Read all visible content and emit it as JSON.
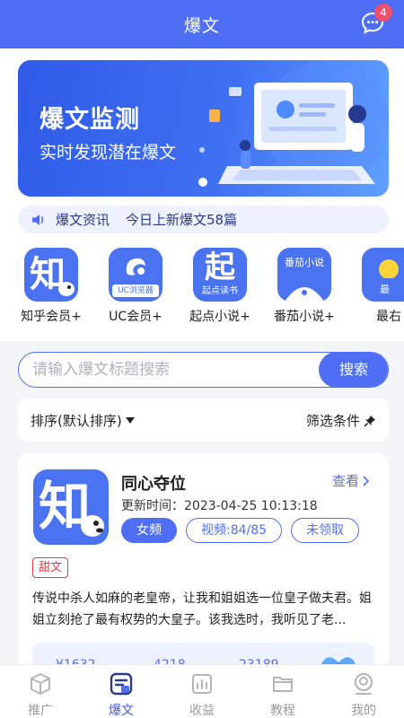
{
  "header": {
    "title": "爆文",
    "message_badge": "4"
  },
  "banner": {
    "title": "爆文监测",
    "subtitle": "实时发现潜在爆文"
  },
  "notice": {
    "label": "爆文资讯",
    "text": "今日上新爆文58篇"
  },
  "apps": [
    {
      "label": "知乎会员+",
      "icon": "zhihu-icon",
      "glyph": "知"
    },
    {
      "label": "UC会员+",
      "icon": "uc-browser-icon",
      "glyph": "UC浏览器"
    },
    {
      "label": "起点小说+",
      "icon": "qidian-icon",
      "glyph": "起",
      "sub": "起点读书"
    },
    {
      "label": "番茄小说+",
      "icon": "fanqie-icon",
      "glyph": "番茄小说"
    },
    {
      "label": "最右",
      "icon": "zuiyou-icon",
      "glyph": "最"
    }
  ],
  "search": {
    "placeholder": "请输入爆文标题搜索",
    "button": "搜索"
  },
  "filters": {
    "sort": "排序(默认排序)",
    "filter": "筛选条件"
  },
  "card": {
    "icon_glyph": "知",
    "title": "同心夺位",
    "view": "查看",
    "update_time": "更新时间：2023-04-25 10:13:18",
    "tags": [
      "女频",
      "视频:84/85",
      "未领取"
    ],
    "genre": "甜文",
    "description": "传说中杀人如麻的老皇帝，让我和姐姐选一位皇子做夫君。姐姐立刻抢了最有权势的大皇子。该我选时，我听见了老...",
    "stats": [
      "¥1632",
      "4218",
      "23189"
    ]
  },
  "tabs": [
    {
      "label": "推广",
      "icon": "promote-icon",
      "active": false
    },
    {
      "label": "爆文",
      "icon": "article-icon",
      "active": true
    },
    {
      "label": "收益",
      "icon": "income-icon",
      "active": false
    },
    {
      "label": "教程",
      "icon": "folder-icon",
      "active": false
    },
    {
      "label": "我的",
      "icon": "profile-icon",
      "active": false
    }
  ],
  "colors": {
    "primary": "#4d6ef5",
    "badge": "#f0506e",
    "genre": "#e03a48",
    "tab_active": "#3c5bdf"
  }
}
